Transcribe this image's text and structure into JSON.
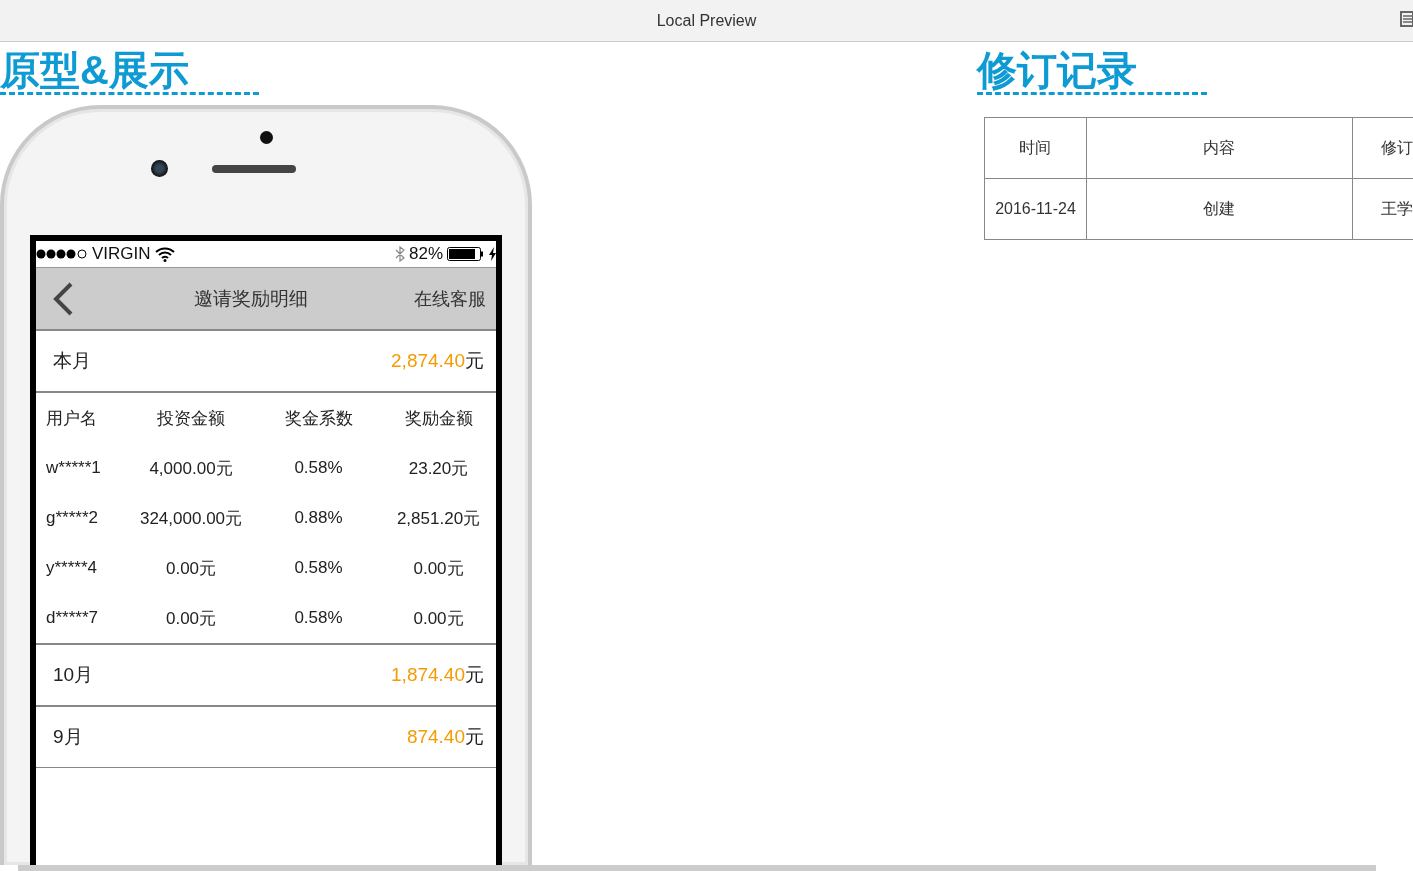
{
  "window": {
    "title": "Local Preview"
  },
  "prototype": {
    "heading": "原型&展示",
    "status_bar": {
      "carrier": "VIRGIN",
      "battery": "82%"
    },
    "nav": {
      "title": "邀请奖励明细",
      "action": "在线客服"
    },
    "months": [
      {
        "label": "本月",
        "amount": "2,874.40",
        "unit": "元",
        "details": {
          "columns": [
            "用户名",
            "投资金额",
            "奖金系数",
            "奖励金额"
          ],
          "rows": [
            [
              "w*****1",
              "4,000.00元",
              "0.58%",
              "23.20元"
            ],
            [
              "g*****2",
              "324,000.00元",
              "0.88%",
              "2,851.20元"
            ],
            [
              "y*****4",
              "0.00元",
              "0.58%",
              "0.00元"
            ],
            [
              "d*****7",
              "0.00元",
              "0.58%",
              "0.00元"
            ]
          ]
        }
      },
      {
        "label": "10月",
        "amount": "1,874.40",
        "unit": "元"
      },
      {
        "label": "9月",
        "amount": "874.40",
        "unit": "元"
      }
    ]
  },
  "revisions": {
    "heading": "修订记录",
    "columns": [
      "时间",
      "内容",
      "修订"
    ],
    "rows": [
      [
        "2016-11-24",
        "创建",
        "王学"
      ]
    ]
  }
}
